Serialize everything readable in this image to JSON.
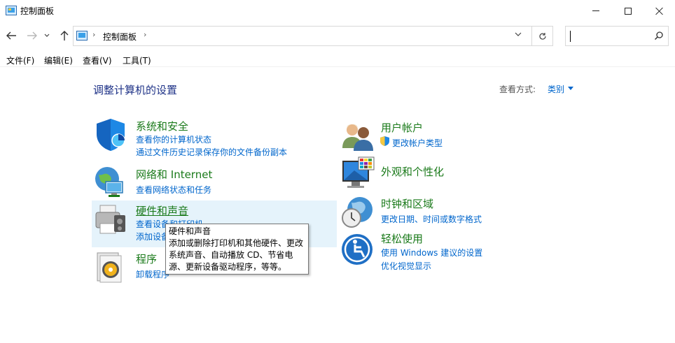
{
  "window": {
    "title": "控制面板",
    "icon": "control-panel-icon"
  },
  "nav": {
    "back_icon": "arrow-left-icon",
    "forward_icon": "arrow-right-icon",
    "recent_icon": "chevron-down-icon",
    "up_icon": "arrow-up-icon",
    "address_path": "控制面板",
    "search_placeholder": ""
  },
  "menu": {
    "items": [
      "文件(F)",
      "编辑(E)",
      "查看(V)",
      "工具(T)"
    ]
  },
  "content": {
    "title": "调整计算机的设置",
    "view_by_label": "查看方式:",
    "view_by_value": "类别"
  },
  "categories": {
    "system": {
      "title": "系统和安全",
      "icon": "shield-icon",
      "links": [
        "查看你的计算机状态",
        "通过文件历史记录保存你的文件备份副本"
      ]
    },
    "network": {
      "title": "网络和 Internet",
      "icon": "network-globe-icon",
      "links": [
        "查看网络状态和任务"
      ]
    },
    "hardware": {
      "title": "硬件和声音",
      "icon": "printer-icon",
      "links": [
        "查看设备和打印机",
        "添加设备"
      ]
    },
    "programs": {
      "title": "程序",
      "icon": "programs-disc-icon",
      "links": [
        "卸载程序"
      ]
    },
    "users": {
      "title": "用户帐户",
      "icon": "users-icon",
      "links": [
        "更改帐户类型"
      ]
    },
    "appearance": {
      "title": "外观和个性化",
      "icon": "monitor-palette-icon",
      "links": []
    },
    "clock": {
      "title": "时钟和区域",
      "icon": "clock-globe-icon",
      "links": [
        "更改日期、时间或数字格式"
      ]
    },
    "ease": {
      "title": "轻松使用",
      "icon": "ease-of-access-icon",
      "links": [
        "使用 Windows 建议的设置",
        "优化视觉显示"
      ]
    }
  },
  "tooltip": {
    "lines": [
      "硬件和声音",
      "添加或删除打印机和其他硬件、更改",
      "系统声音、自动播放 CD、节省电",
      "源、更新设备驱动程序，等等。"
    ]
  },
  "colors": {
    "category_title": "#1a7a1a",
    "link": "#0066cc",
    "heading": "#1e3287",
    "hover": "#e5f3fb"
  }
}
